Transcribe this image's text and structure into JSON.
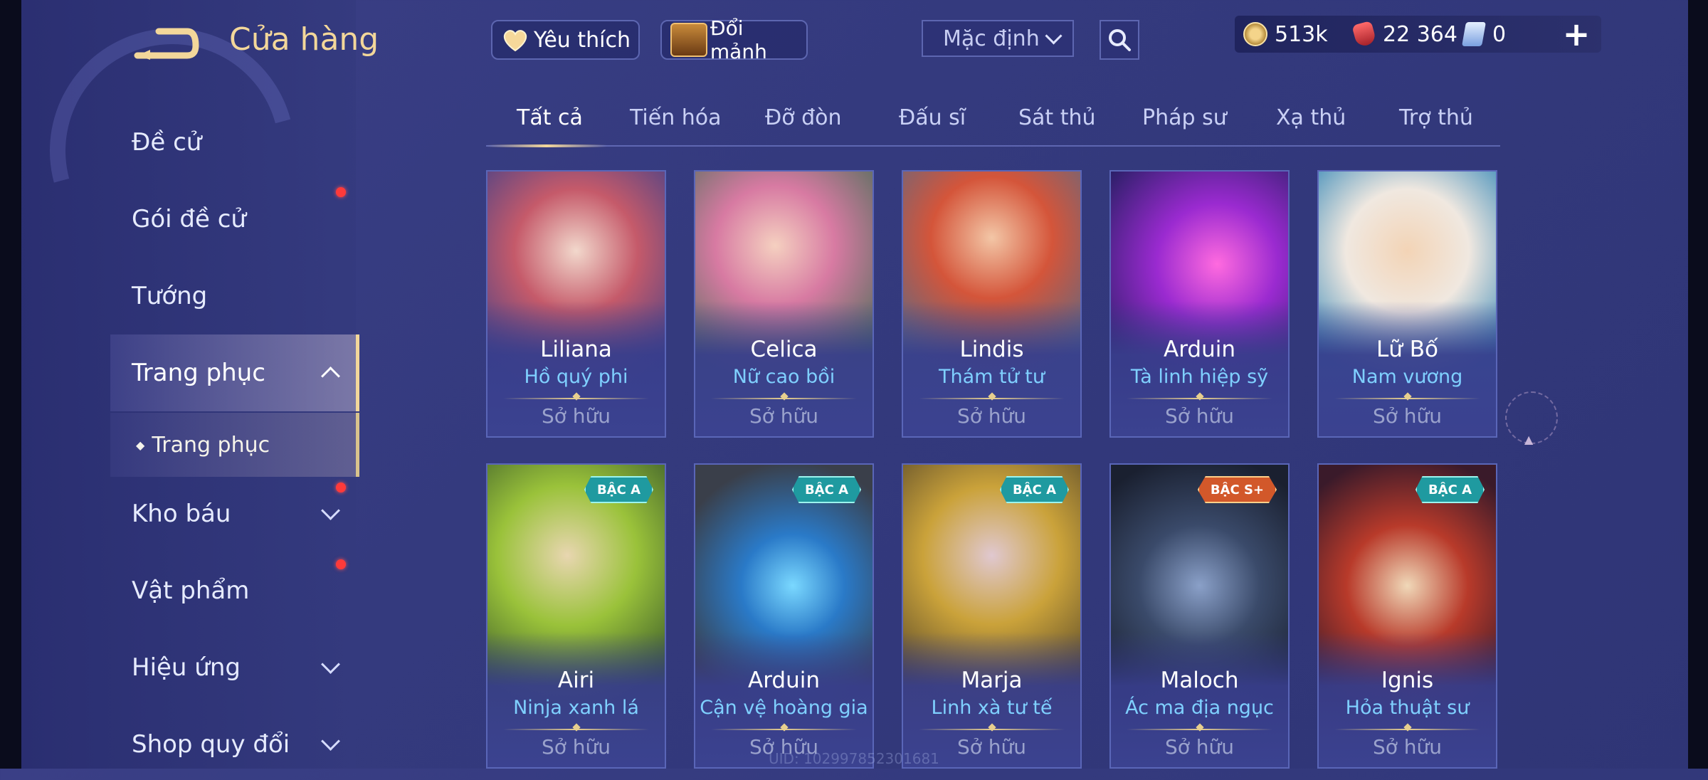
{
  "header": {
    "title": "Cửa hàng",
    "favorites_label": "Yêu thích",
    "exchange_label": "Đổi mảnh",
    "sort_value": "Mặc định"
  },
  "currency": {
    "gold": "513k",
    "vouchers": "22 364",
    "tickets": "0"
  },
  "sidebar": {
    "items": [
      {
        "label": "Đề cử"
      },
      {
        "label": "Gói đề cử"
      },
      {
        "label": "Tướng"
      },
      {
        "label": "Trang phục"
      },
      {
        "label": "Kho báu"
      },
      {
        "label": "Vật phẩm"
      },
      {
        "label": "Hiệu ứng"
      },
      {
        "label": "Shop quy đổi"
      }
    ],
    "sub_item": "Trang phục"
  },
  "tabs": [
    "Tất cả",
    "Tiến hóa",
    "Đỡ đòn",
    "Đấu sĩ",
    "Sát thủ",
    "Pháp sư",
    "Xạ thủ",
    "Trợ thủ"
  ],
  "cards": [
    {
      "hero": "Liliana",
      "skin": "Hồ quý phi",
      "status": "Sở hữu",
      "badge": ""
    },
    {
      "hero": "Celica",
      "skin": "Nữ cao bồi",
      "status": "Sở hữu",
      "badge": ""
    },
    {
      "hero": "Lindis",
      "skin": "Thám tử tư",
      "status": "Sở hữu",
      "badge": ""
    },
    {
      "hero": "Arduin",
      "skin": "Tà linh hiệp sỹ",
      "status": "Sở hữu",
      "badge": ""
    },
    {
      "hero": "Lữ Bố",
      "skin": "Nam vương",
      "status": "Sở hữu",
      "badge": ""
    },
    {
      "hero": "Airi",
      "skin": "Ninja xanh lá",
      "status": "Sở hữu",
      "badge": "BẬC A"
    },
    {
      "hero": "Arduin",
      "skin": "Cận vệ hoàng gia",
      "status": "Sở hữu",
      "badge": "BẬC A"
    },
    {
      "hero": "Marja",
      "skin": "Linh xà tư tế",
      "status": "Sở hữu",
      "badge": "BẬC A"
    },
    {
      "hero": "Maloch",
      "skin": "Ác ma địa ngục",
      "status": "Sở hữu",
      "badge": "BẬC S+"
    },
    {
      "hero": "Ignis",
      "skin": "Hỏa thuật sư",
      "status": "Sở hữu",
      "badge": "BẬC A"
    }
  ],
  "footer": {
    "uid": "UID: 102997852301681"
  },
  "colors": {
    "accent_gold": "#f3d79a",
    "skin_name": "#7fd0ff",
    "badge_a": "#1f9aa0",
    "badge_splus": "#d2582a",
    "notify": "#ff3a3a"
  }
}
